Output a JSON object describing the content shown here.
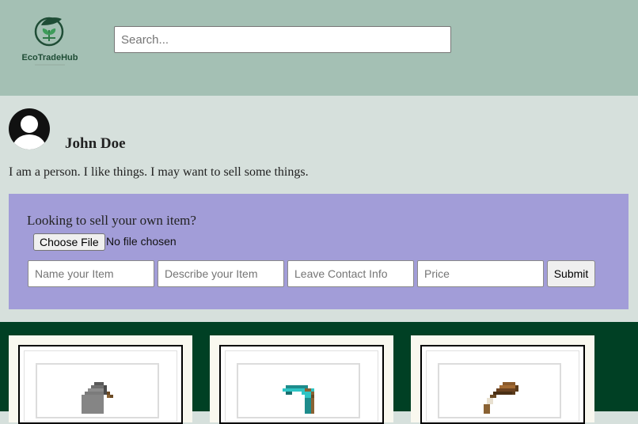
{
  "header": {
    "brand": "EcoTradeHub",
    "search_placeholder": "Search..."
  },
  "profile": {
    "name": "John Doe",
    "bio": "I am a person. I like things. I may want to sell some things."
  },
  "sell_form": {
    "title": "Looking to sell your own item?",
    "choose_file_label": "Choose File",
    "file_status": "No file chosen",
    "fields": [
      {
        "placeholder": "Name your Item"
      },
      {
        "placeholder": "Describe your Item"
      },
      {
        "placeholder": "Leave Contact Info"
      },
      {
        "placeholder": "Price"
      }
    ],
    "submit_label": "Submit"
  },
  "items": [
    {
      "icon": "stone-shovel-icon"
    },
    {
      "icon": "diamond-pickaxe-icon"
    },
    {
      "icon": "wooden-axe-icon"
    }
  ],
  "colors": {
    "header_bg": "#a4c0b4",
    "profile_bg": "#d6e0dc",
    "panel_bg": "#a29dd8",
    "items_bg": "#004024"
  }
}
